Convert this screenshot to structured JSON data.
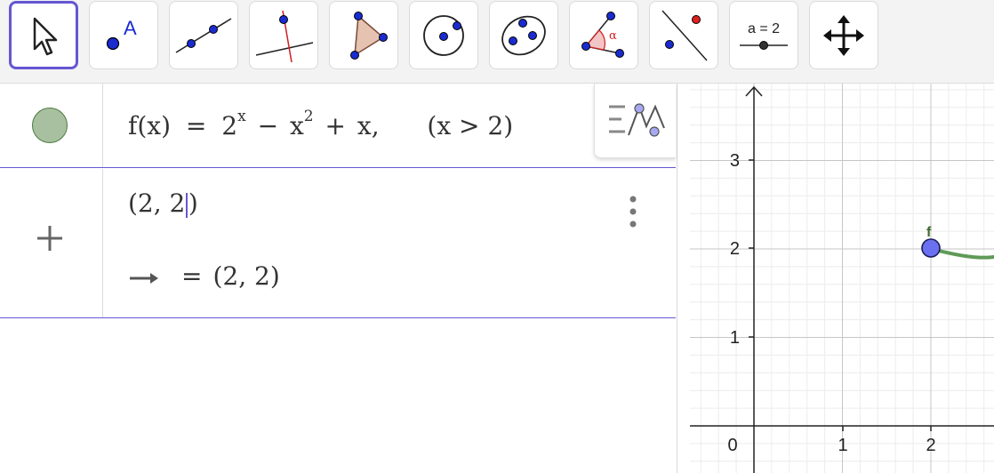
{
  "toolbar": {
    "tools": [
      {
        "name": "move-tool",
        "label": ""
      },
      {
        "name": "point-tool",
        "label": "A"
      },
      {
        "name": "line-tool",
        "label": ""
      },
      {
        "name": "perpendicular-line-tool",
        "label": ""
      },
      {
        "name": "polygon-tool",
        "label": ""
      },
      {
        "name": "circle-center-point-tool",
        "label": ""
      },
      {
        "name": "ellipse-tool",
        "label": ""
      },
      {
        "name": "angle-tool",
        "label": "α"
      },
      {
        "name": "reflect-about-line-tool",
        "label": ""
      },
      {
        "name": "slider-tool",
        "label": "a = 2"
      },
      {
        "name": "move-graphics-view-tool",
        "label": ""
      }
    ],
    "active_tool": "move-tool"
  },
  "algebra": {
    "function_row": {
      "name": "f(x)",
      "equals": "=",
      "base": "2",
      "exp1": "x",
      "minus": "−",
      "var": "x",
      "exp2": "2",
      "plus": "+",
      "tail": "x,",
      "condition": "(x > 2)",
      "marble_color": "#a8c0a0"
    },
    "input_row": {
      "text_before_caret": "(2, 2",
      "text_after_caret": ")",
      "output_equals": "=",
      "output_value": "(2, 2)"
    }
  },
  "graphics": {
    "x_ticks": [
      "0",
      "1",
      "2"
    ],
    "y_ticks": [
      "1",
      "2",
      "3"
    ],
    "function_label": "f",
    "point_color": "#6b70f0",
    "curve_color": "#5f9a57",
    "label_color": "#3e6a2e"
  }
}
